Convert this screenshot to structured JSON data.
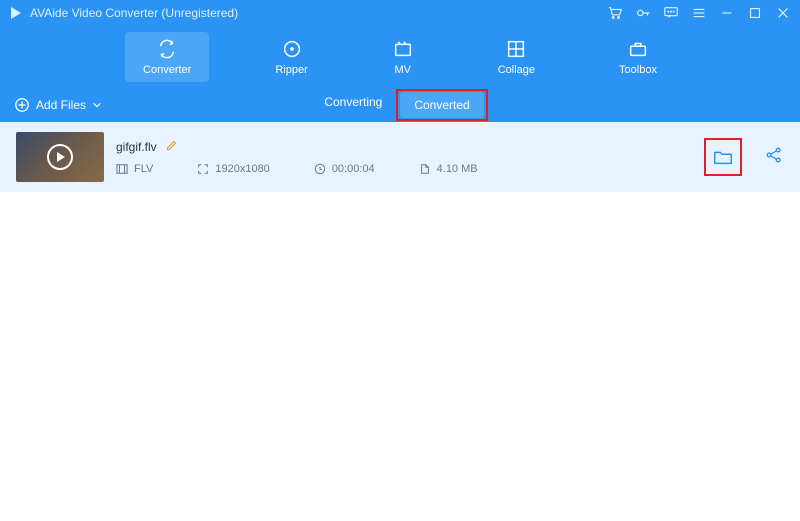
{
  "window": {
    "title": "AVAide Video Converter (Unregistered)"
  },
  "mainnav": {
    "items": [
      {
        "label": "Converter"
      },
      {
        "label": "Ripper"
      },
      {
        "label": "MV"
      },
      {
        "label": "Collage"
      },
      {
        "label": "Toolbox"
      }
    ],
    "active_index": 0
  },
  "subnav": {
    "add_files_label": "Add Files",
    "tabs": {
      "converting": "Converting",
      "converted": "Converted"
    },
    "active_tab": "converted"
  },
  "file_row": {
    "filename": "gifgif.flv",
    "format": "FLV",
    "resolution": "1920x1080",
    "duration": "00:00:04",
    "size": "4.10 MB"
  },
  "highlights": {
    "converted_tab": true,
    "open_folder_button": true
  }
}
